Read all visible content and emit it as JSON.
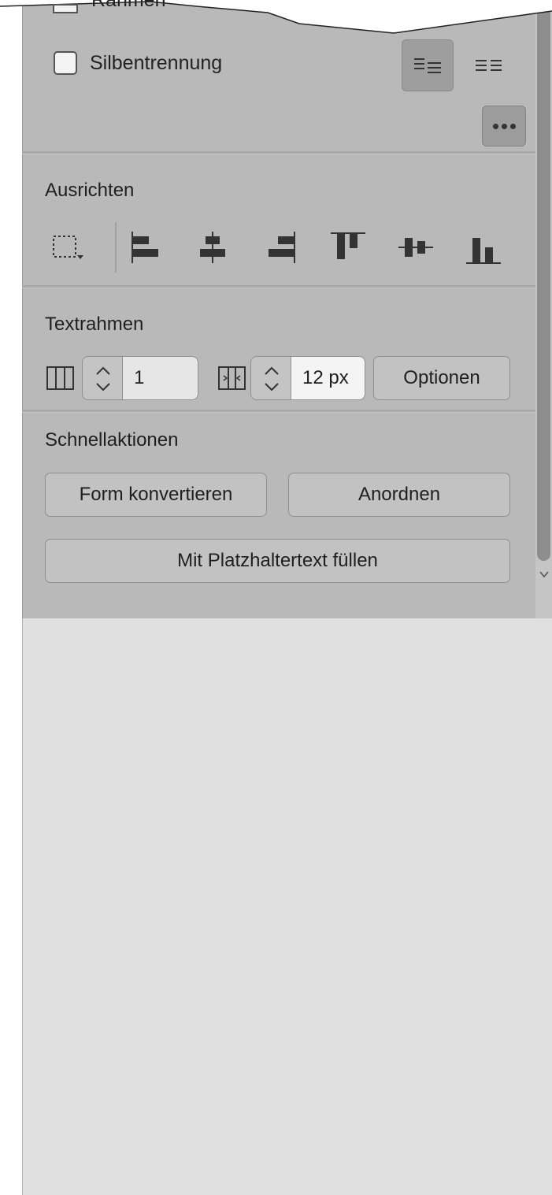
{
  "top_section": {
    "partial_checkbox_label": "Rahmen",
    "hyphenation_checkbox": {
      "label": "Silbentrennung",
      "checked": false
    },
    "text_layout_options": [
      "text-align-left-icon",
      "text-justify-icon"
    ],
    "more_options_icon": "more-options-icon"
  },
  "align_section": {
    "title": "Ausrichten",
    "icons": [
      "align-to-selection-icon",
      "align-left-edges-icon",
      "align-horizontal-centers-icon",
      "align-right-edges-icon",
      "align-top-edges-icon",
      "align-vertical-centers-icon",
      "align-bottom-edges-icon"
    ]
  },
  "text_frame_section": {
    "title": "Textrahmen",
    "columns_value": "1",
    "gutter_value": "12 px",
    "options_button": "Optionen"
  },
  "quick_actions_section": {
    "title": "Schnellaktionen",
    "convert_shape_button": "Form konvertieren",
    "arrange_button": "Anordnen",
    "fill_placeholder_button": "Mit Platzhaltertext füllen"
  },
  "colors": {
    "panel_bg": "#b9b9b9",
    "outer_bg": "#e0e0e0",
    "scroll_thumb": "#8e8e8e"
  }
}
